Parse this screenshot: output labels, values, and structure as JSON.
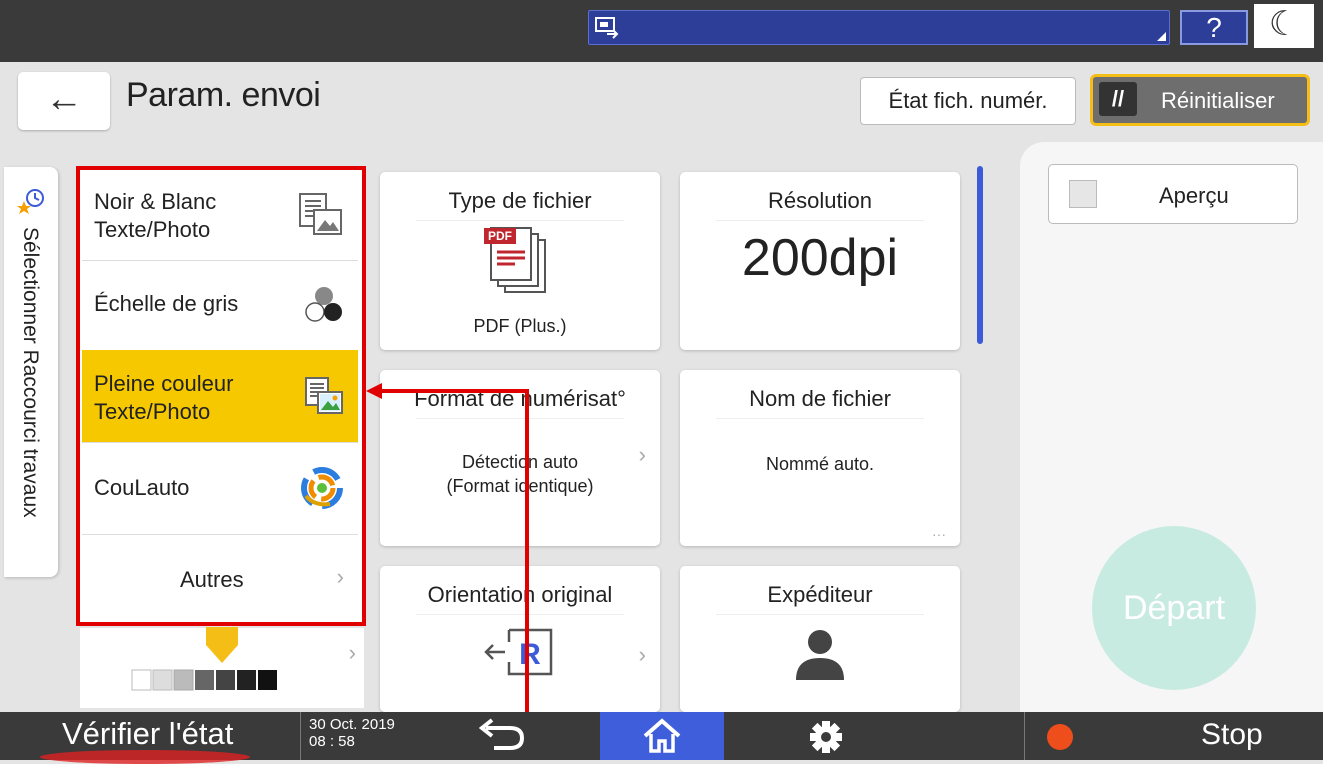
{
  "header": {
    "title": "Param. envoi",
    "scan_file_status": "État fich. numér.",
    "reset": "Réinitialiser",
    "help": "?"
  },
  "sidetab": {
    "label": "Sélectionner Raccourci travaux"
  },
  "color_modes": [
    {
      "label": "Noir & Blanc\nTexte/Photo",
      "icon": "bw-text-photo-icon",
      "selected": false
    },
    {
      "label": "Échelle de gris",
      "icon": "grayscale-icon",
      "selected": false
    },
    {
      "label": "Pleine couleur\nTexte/Photo",
      "icon": "full-color-text-photo-icon",
      "selected": true
    },
    {
      "label": "CouLauto",
      "icon": "auto-color-icon",
      "selected": false
    },
    {
      "label": "Autres",
      "icon": "chevron-right-icon",
      "selected": false
    }
  ],
  "cards": {
    "file_type": {
      "title": "Type de fichier",
      "value": "PDF (Plus.)",
      "badge": "PDF"
    },
    "resolution": {
      "title": "Résolution",
      "value": "200dpi"
    },
    "scan_size": {
      "title": "Format de numérisat°",
      "value": "Détection auto\n(Format identique)"
    },
    "file_name": {
      "title": "Nom de fichier",
      "value": "Nommé auto."
    },
    "orientation": {
      "title": "Orientation original",
      "icon_letter": "R"
    },
    "sender": {
      "title": "Expéditeur"
    }
  },
  "right_panel": {
    "preview": "Aperçu",
    "start": "Départ"
  },
  "bottom_bar": {
    "check_status": "Vérifier l'état",
    "date": "30 Oct. 2019",
    "time": "08 : 58",
    "stop": "Stop"
  },
  "colors": {
    "accent_blue": "#3f5edb",
    "selected_yellow": "#f5c800",
    "reset_border": "#f5be17",
    "annotation_red": "#e00000",
    "start_mint": "#c8ebe1",
    "stop_orange": "#ee4e1c"
  },
  "density": {
    "selected_step": 4,
    "steps": 7
  }
}
